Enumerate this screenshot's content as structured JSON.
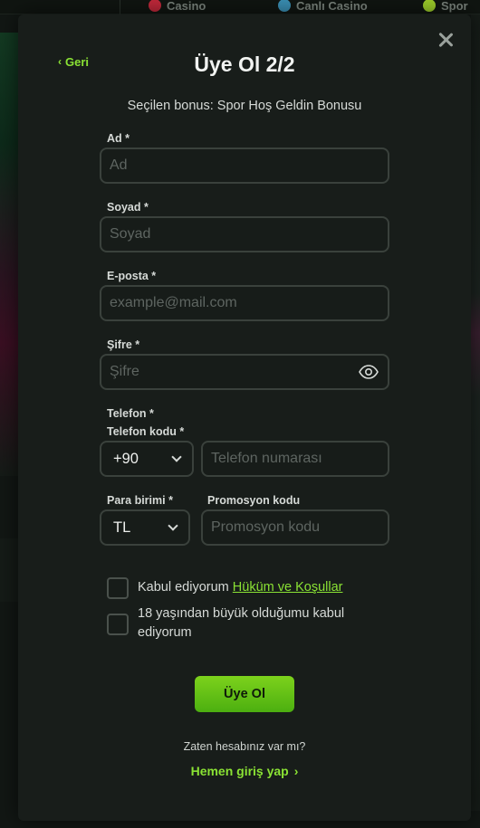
{
  "background": {
    "topnav": [
      {
        "label": "Casino",
        "icon": "cherries-icon",
        "color": "#c0283a"
      },
      {
        "label": "Canlı Casino",
        "icon": "globe-icon",
        "color": "#3a8fb4"
      },
      {
        "label": "Spor",
        "icon": "tennis-ball-icon",
        "color": "#9ccc2a"
      }
    ]
  },
  "modal": {
    "back_label": "Geri",
    "title": "Üye Ol 2/2",
    "subtitle": "Seçilen bonus: Spor Hoş Geldin Bonusu",
    "fields": {
      "first_name": {
        "label": "Ad *",
        "placeholder": "Ad"
      },
      "last_name": {
        "label": "Soyad *",
        "placeholder": "Soyad"
      },
      "email": {
        "label": "E-posta *",
        "placeholder": "example@mail.com"
      },
      "password": {
        "label": "Şifre *",
        "placeholder": "Şifre"
      },
      "phone": {
        "label": "Telefon *",
        "code_label": "Telefon kodu *",
        "code_value": "+90",
        "number_placeholder": "Telefon numarası"
      },
      "currency": {
        "label": "Para birimi *",
        "value": "TL"
      },
      "promo": {
        "label": "Promosyon kodu",
        "placeholder": "Promosyon kodu"
      }
    },
    "checkboxes": {
      "terms_prefix": "Kabul ediyorum ",
      "terms_link": "Hüküm ve Koşullar",
      "age_text": "18 yaşından büyük olduğumu kabul ediyorum"
    },
    "submit_label": "Üye Ol",
    "login_question": "Zaten hesabınız var mı?",
    "login_link": "Hemen giriş yap"
  },
  "colors": {
    "accent": "#8ae234",
    "button_green": "#6cc419",
    "modal_bg": "#181d1a",
    "input_border": "#3a413c"
  }
}
